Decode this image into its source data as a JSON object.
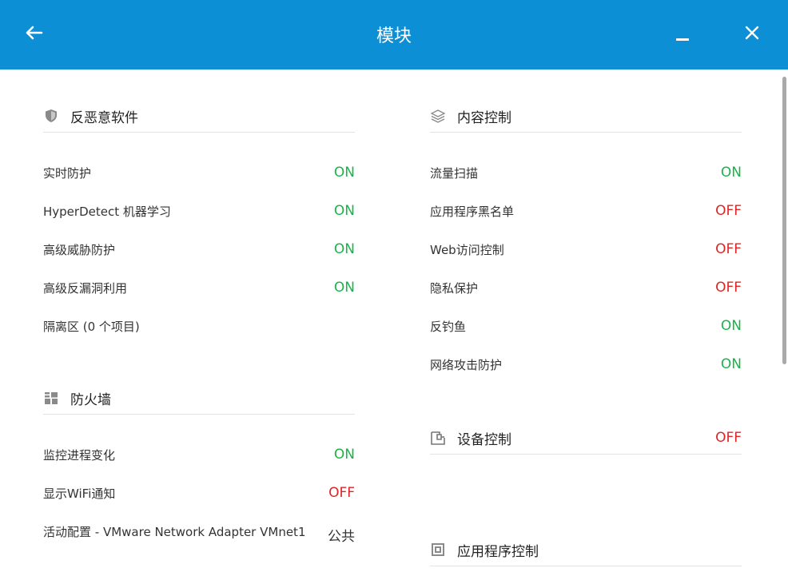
{
  "header": {
    "title": "模块"
  },
  "left": {
    "antimalware": {
      "title": "反恶意软件",
      "items": [
        {
          "label": "实时防护",
          "state": "ON"
        },
        {
          "label": "HyperDetect 机器学习",
          "state": "ON"
        },
        {
          "label": "高级威胁防护",
          "state": "ON"
        },
        {
          "label": "高级反漏洞利用",
          "state": "ON"
        }
      ],
      "quarantine_link": "隔离区 (0 个项目)"
    },
    "firewall": {
      "title": "防火墙",
      "items": [
        {
          "label": "监控进程变化",
          "state": "ON"
        },
        {
          "label": "显示WiFi通知",
          "state": "OFF"
        },
        {
          "label": "活动配置 - VMware Network Adapter VMnet1",
          "state": "公共"
        }
      ]
    }
  },
  "right": {
    "content_control": {
      "title": "内容控制",
      "items": [
        {
          "label": "流量扫描",
          "state": "ON"
        },
        {
          "label": "应用程序黑名单",
          "state": "OFF"
        },
        {
          "label": "Web访问控制",
          "state": "OFF"
        },
        {
          "label": "隐私保护",
          "state": "OFF"
        },
        {
          "label": "反钓鱼",
          "state": "ON"
        },
        {
          "label": "网络攻击防护",
          "state": "ON"
        }
      ]
    },
    "device_control": {
      "title": "设备控制",
      "state": "OFF"
    },
    "app_control": {
      "title": "应用程序控制"
    }
  },
  "colors": {
    "header_bg": "#0d8fd6",
    "on": "#1ab34a",
    "off": "#e02424",
    "link": "#1a8fd8"
  },
  "icons": {
    "back": "arrow-left-icon",
    "minimize": "minimize-icon",
    "close": "close-icon",
    "antimalware": "shield-icon",
    "firewall": "firewall-icon",
    "content_control": "layers-icon",
    "device_control": "device-icon",
    "app_control": "app-icon"
  }
}
